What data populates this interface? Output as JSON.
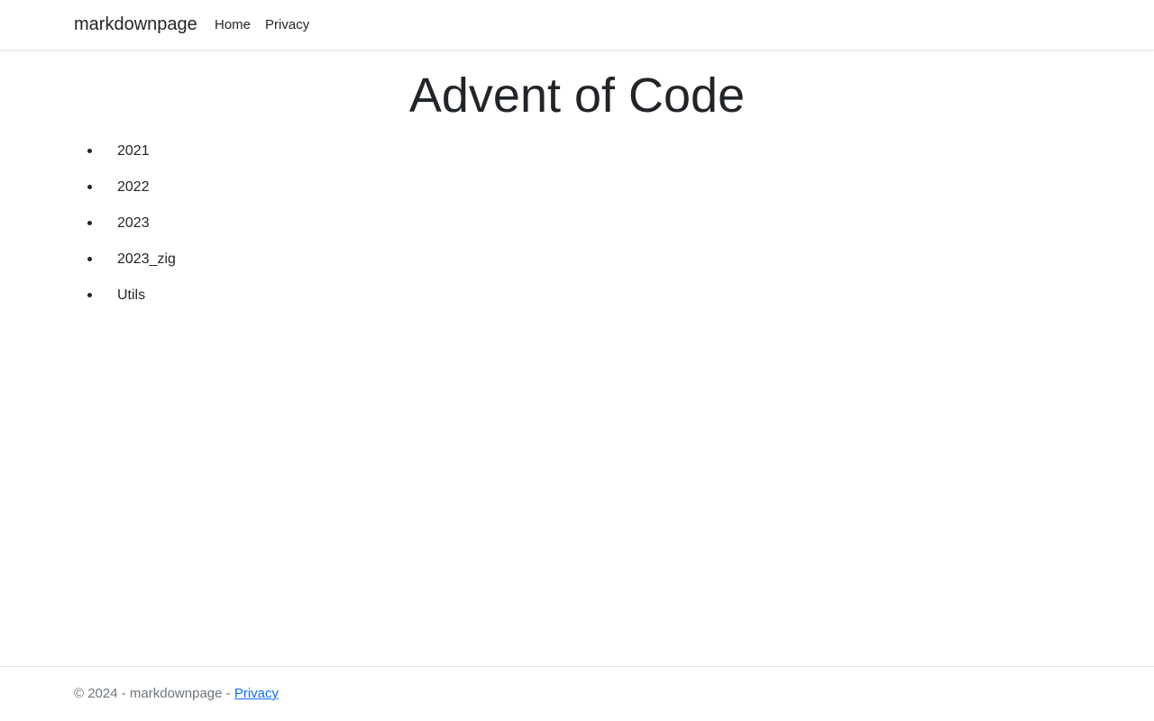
{
  "navbar": {
    "brand": "markdownpage",
    "links": [
      {
        "label": "Home"
      },
      {
        "label": "Privacy"
      }
    ]
  },
  "main": {
    "title": "Advent of Code",
    "items": [
      {
        "label": "2021"
      },
      {
        "label": "2022"
      },
      {
        "label": "2023"
      },
      {
        "label": "2023_zig"
      },
      {
        "label": "Utils"
      }
    ]
  },
  "footer": {
    "copyright": "© 2024 - markdownpage - ",
    "privacy_link": "Privacy"
  },
  "colors": {
    "text": "#212529",
    "muted": "#6c757d",
    "link": "#0d6efd",
    "border": "#dee2e6"
  }
}
